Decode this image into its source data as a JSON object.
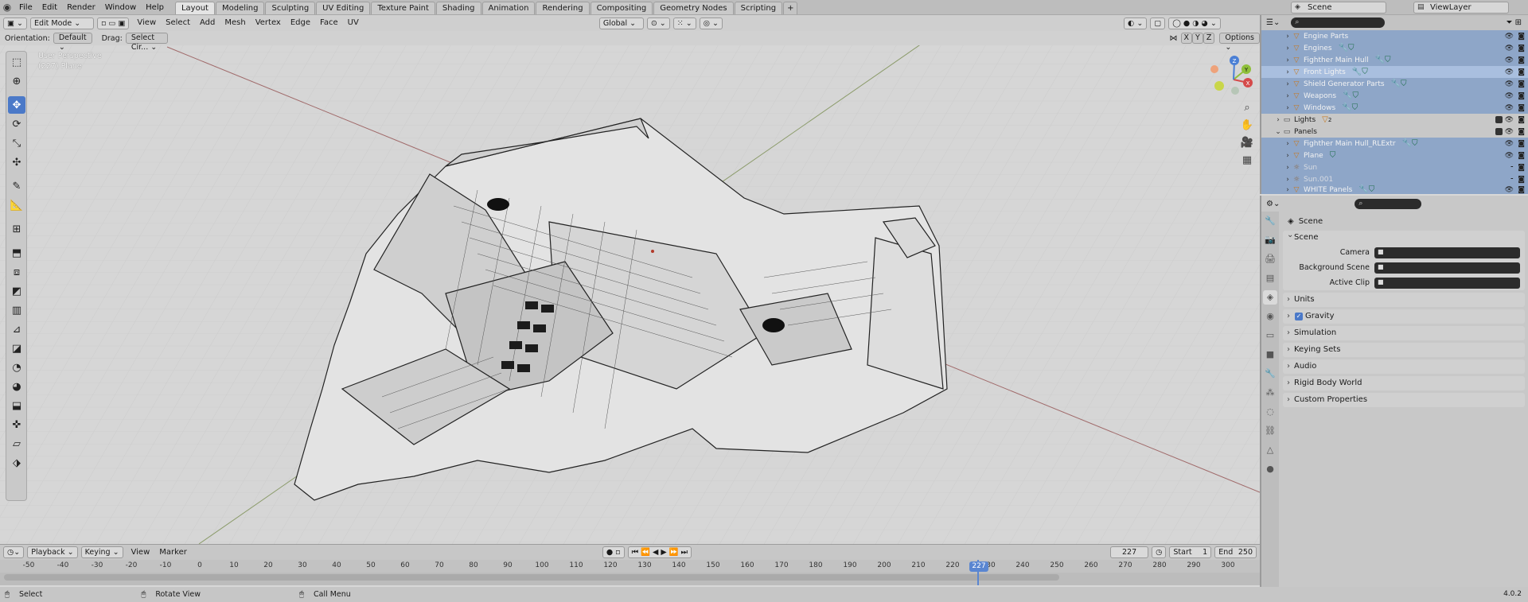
{
  "menubar": {
    "items": [
      "File",
      "Edit",
      "Render",
      "Window",
      "Help"
    ]
  },
  "workspaces": {
    "tabs": [
      "Layout",
      "Modeling",
      "Sculpting",
      "UV Editing",
      "Texture Paint",
      "Shading",
      "Animation",
      "Rendering",
      "Compositing",
      "Geometry Nodes",
      "Scripting"
    ],
    "active": "Layout",
    "add": "+"
  },
  "scene_selector": {
    "scene": "Scene",
    "view_layer": "ViewLayer"
  },
  "viewport": {
    "mode": "Edit Mode",
    "menus": [
      "View",
      "Select",
      "Add",
      "Mesh",
      "Vertex",
      "Edge",
      "Face",
      "UV"
    ],
    "transform_orientation": "Global",
    "orientation_label": "Orientation:",
    "orientation_value": "Default",
    "drag_label": "Drag:",
    "drag_value": "Select Cir...",
    "axis_x": "X",
    "axis_y": "Y",
    "axis_z": "Z",
    "options": "Options",
    "info_line1": "User Perspective",
    "info_line2": "(227) Plane"
  },
  "tools": [
    {
      "name": "select-box-icon",
      "active": false
    },
    {
      "name": "cursor-icon",
      "active": false
    },
    {
      "name": "move-icon",
      "active": true
    },
    {
      "name": "rotate-icon",
      "active": false
    },
    {
      "name": "scale-icon",
      "active": false
    },
    {
      "name": "transform-icon",
      "active": false
    },
    {
      "name": "annotate-icon",
      "active": false
    },
    {
      "name": "measure-icon",
      "active": false
    },
    {
      "name": "add-cube-icon",
      "active": false
    },
    {
      "name": "extrude-icon",
      "active": false
    },
    {
      "name": "inset-icon",
      "active": false
    },
    {
      "name": "bevel-icon",
      "active": false
    },
    {
      "name": "loop-cut-icon",
      "active": false
    },
    {
      "name": "knife-icon",
      "active": false
    },
    {
      "name": "poly-build-icon",
      "active": false
    },
    {
      "name": "spin-icon",
      "active": false
    },
    {
      "name": "smooth-icon",
      "active": false
    },
    {
      "name": "edge-slide-icon",
      "active": false
    },
    {
      "name": "shrink-fatten-icon",
      "active": false
    },
    {
      "name": "shear-icon",
      "active": false
    },
    {
      "name": "rip-icon",
      "active": false
    }
  ],
  "gizmo": {
    "x": "X",
    "y": "Y",
    "z": "Z"
  },
  "outliner": {
    "rows": [
      {
        "label": "Engine Parts",
        "style": "sel"
      },
      {
        "label": "Engines",
        "style": "sel"
      },
      {
        "label": "Fighther Main Hull",
        "style": "sel"
      },
      {
        "label": "Front Lights",
        "style": "hl"
      },
      {
        "label": "Shield Generator Parts",
        "style": "sel"
      },
      {
        "label": "Weapons",
        "style": "sel"
      },
      {
        "label": "Windows",
        "style": "sel"
      },
      {
        "label": "Lights",
        "style": "plain"
      },
      {
        "label": "Panels",
        "style": "plain"
      },
      {
        "label": "Fighther Main Hull_RLExtr",
        "style": "sel"
      },
      {
        "label": "Plane",
        "style": "sel"
      },
      {
        "label": "Sun",
        "style": "dim"
      },
      {
        "label": "Sun.001",
        "style": "dim"
      },
      {
        "label": "WHITE Panels",
        "style": "sel"
      }
    ],
    "lights_count": "2"
  },
  "properties": {
    "context": "Scene",
    "open_panel": "Scene",
    "fields": [
      {
        "label": "Camera"
      },
      {
        "label": "Background Scene"
      },
      {
        "label": "Active Clip"
      }
    ],
    "panels": [
      "Units",
      "Gravity",
      "Simulation",
      "Keying Sets",
      "Audio",
      "Rigid Body World",
      "Custom Properties"
    ]
  },
  "timeline": {
    "menus": [
      "Playback",
      "Keying",
      "View",
      "Marker"
    ],
    "current_frame": "227",
    "start_label": "Start",
    "start": "1",
    "end_label": "End",
    "end": "250",
    "ticks": [
      "-50",
      "-40",
      "-30",
      "-20",
      "-10",
      "0",
      "10",
      "20",
      "30",
      "40",
      "50",
      "60",
      "70",
      "80",
      "90",
      "100",
      "110",
      "120",
      "130",
      "140",
      "150",
      "160",
      "170",
      "180",
      "190",
      "200",
      "210",
      "220",
      "30",
      "240",
      "250",
      "260",
      "270",
      "280",
      "290",
      "300"
    ]
  },
  "statusbar": {
    "items": [
      "Select",
      "Rotate View",
      "Call Menu"
    ],
    "version": "4.0.2"
  }
}
